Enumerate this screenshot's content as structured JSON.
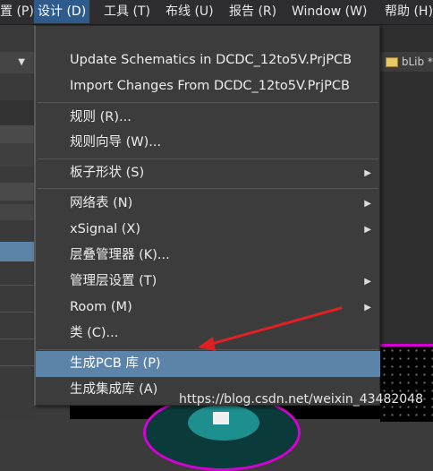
{
  "menubar": {
    "items": [
      {
        "label": "置 (P)"
      },
      {
        "label": "设计 (D)",
        "active": true
      },
      {
        "label": "工具 (T)"
      },
      {
        "label": "布线 (U)"
      },
      {
        "label": "报告 (R)"
      },
      {
        "label": "Window (W)"
      },
      {
        "label": "帮助 (H)"
      }
    ]
  },
  "left_panel": {
    "dropdown_icon": "triangle-down-icon"
  },
  "document_tab": {
    "label": "bLib *",
    "icon": "pcb-library-icon"
  },
  "design_menu": {
    "items": [
      {
        "label": "Update Schematics in DCDC_12to5V.PrjPCB",
        "submenu": false
      },
      {
        "label": "Import Changes From DCDC_12to5V.PrjPCB",
        "submenu": false
      },
      {
        "label": "规则 (R)...",
        "submenu": false
      },
      {
        "label": "规则向导 (W)...",
        "submenu": false
      },
      {
        "label": "板子形状 (S)",
        "submenu": true
      },
      {
        "label": "网络表 (N)",
        "submenu": true
      },
      {
        "label": "xSignal (X)",
        "submenu": true
      },
      {
        "label": "层叠管理器 (K)...",
        "submenu": false
      },
      {
        "label": "管理层设置 (T)",
        "submenu": true
      },
      {
        "label": "Room (M)",
        "submenu": true
      },
      {
        "label": "类 (C)...",
        "submenu": false
      },
      {
        "label": "生成PCB 库 (P)",
        "submenu": false,
        "highlighted": true
      },
      {
        "label": "生成集成库 (A)",
        "submenu": false
      }
    ],
    "submenu_arrow_icon": "chevron-right-icon"
  },
  "watermark": "https://blog.csdn.net/weixin_43482048",
  "colors": {
    "menubar_bg": "#2d2d30",
    "menu_bg": "#3c3c3c",
    "highlight": "#5b84a8",
    "active_menu": "#2f5b8c",
    "annotation_arrow": "#e02020",
    "pcb_outline": "#d400d4"
  }
}
